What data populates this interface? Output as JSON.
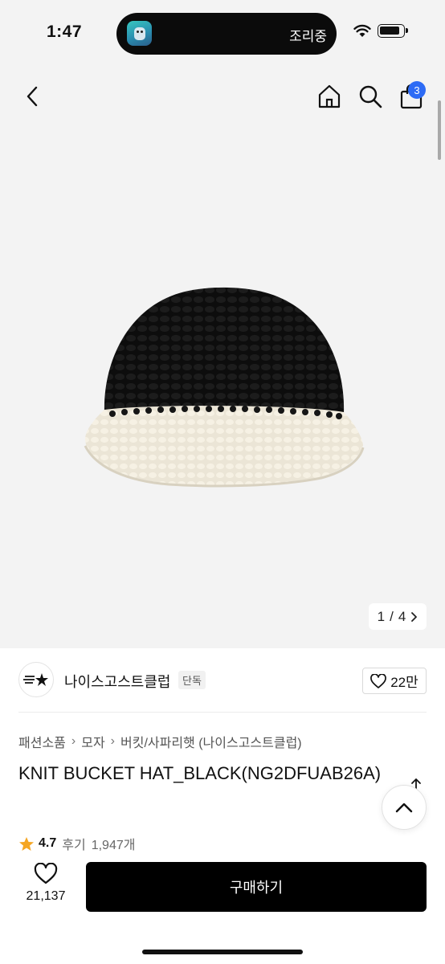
{
  "status_bar": {
    "time": "1:47",
    "activity_label": "조리중",
    "icons": [
      "app-icon",
      "wifi-icon",
      "battery-icon"
    ]
  },
  "header": {
    "back_icon": "chevron-left-icon",
    "home_icon": "home-icon",
    "search_icon": "search-icon",
    "cart_icon": "shopping-bag-icon",
    "cart_count": "3"
  },
  "gallery": {
    "current": "1",
    "separator": "/",
    "total": "4"
  },
  "brand": {
    "name": "나이스고스트클럽",
    "tag": "단독",
    "like_count": "22만"
  },
  "breadcrumb": [
    "패션소품",
    "모자",
    "버킷/사파리햇 (나이스고스트클럽)"
  ],
  "product": {
    "title": "KNIT BUCKET HAT_BLACK(NG2DFUAB26A)",
    "rating": "4.7",
    "review_label": "후기",
    "review_count": "1,947개"
  },
  "bottom_bar": {
    "wish_count": "21,137",
    "buy_label": "구매하기"
  },
  "colors": {
    "accent_badge": "#2d6bf5",
    "buy_button": "#000000",
    "star": "#f5a623"
  }
}
